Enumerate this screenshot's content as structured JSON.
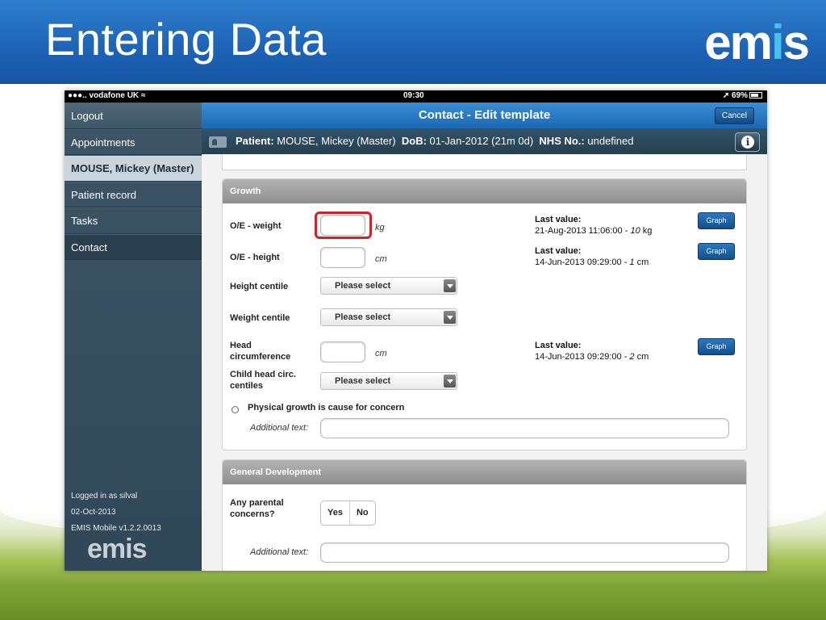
{
  "slide": {
    "title": "Entering Data",
    "brand": {
      "left": "em",
      "accent": "i",
      "right": "s"
    },
    "brand_accent_color": "#47c1ea",
    "header_color": "#1e64b7"
  },
  "statusbar": {
    "carrier": "vodafone UK",
    "time": "09:30",
    "battery": "69%"
  },
  "sidebar": {
    "items": [
      {
        "label": "Logout"
      },
      {
        "label": "Appointments"
      },
      {
        "label": "MOUSE, Mickey (Master)"
      },
      {
        "label": "Patient record"
      },
      {
        "label": "Tasks"
      },
      {
        "label": "Contact"
      }
    ],
    "footer": {
      "user": "Logged in as silval",
      "date": "02-Oct-2013",
      "version": "EMIS Mobile v1.2.2.0013"
    },
    "logo": "emis"
  },
  "topbar": {
    "title": "Contact - Edit template",
    "cancel": "Cancel"
  },
  "patient": {
    "label": "Patient:",
    "name": "MOUSE, Mickey (Master)",
    "dob_label": "DoB:",
    "dob": "01-Jan-2012 (21m 0d)",
    "nhs_label": "NHS No.:",
    "nhs": "undefined",
    "info_icon": "i"
  },
  "growth": {
    "title": "Growth",
    "weight": {
      "label": "O/E - weight",
      "unit": "kg",
      "last_title": "Last value:",
      "last_date": "21-Aug-2013 11:06:00 - ",
      "last_num": "10",
      "last_unit": " kg",
      "graph": "Graph"
    },
    "height": {
      "label": "O/E - height",
      "unit": "cm",
      "last_title": "Last value:",
      "last_date": "14-Jun-2013 09:29:00 - ",
      "last_num": "1",
      "last_unit": " cm",
      "graph": "Graph"
    },
    "height_centile": {
      "label": "Height centile",
      "value": "Please select"
    },
    "weight_centile": {
      "label": "Weight centile",
      "value": "Please select"
    },
    "head": {
      "label_line1": "Head",
      "label_line2": "circumference",
      "unit": "cm",
      "last_title": "Last value:",
      "last_date": "14-Jun-2013 09:29:00 - ",
      "last_num": "2",
      "last_unit": " cm",
      "graph": "Graph"
    },
    "head_centiles": {
      "label_line1": "Child head circ.",
      "label_line2": "centiles",
      "value": "Please select"
    },
    "concern": "Physical growth is cause for concern",
    "additional_label": "Additional text:"
  },
  "development": {
    "title": "General Development",
    "parental_line1": "Any parental",
    "parental_line2": "concerns?",
    "yes": "Yes",
    "no": "No",
    "additional_label": "Additional text:"
  }
}
